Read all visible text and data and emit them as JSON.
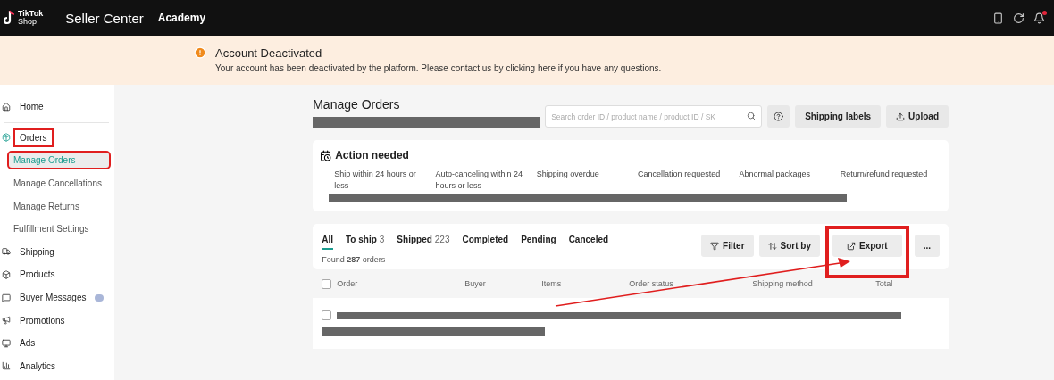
{
  "header": {
    "logo_top": "TikTok",
    "logo_bottom": "Shop",
    "product": "Seller Center",
    "link": "Academy",
    "notification_dot": true
  },
  "banner": {
    "title": "Account Deactivated",
    "message_before": "Your account has been deactivated by the platform. Please contact us by clicking",
    "link": "here",
    "message_after": "if you have any questions."
  },
  "sidebar": {
    "items": [
      {
        "label": "Home",
        "selected": false,
        "highlighted": false
      },
      {
        "label": "Orders",
        "selected": false,
        "highlighted": true,
        "children": [
          {
            "label": "Manage Orders",
            "selected": true,
            "highlighted": true
          },
          {
            "label": "Manage Cancellations",
            "selected": false,
            "highlighted": false
          },
          {
            "label": "Manage Returns",
            "selected": false,
            "highlighted": false
          },
          {
            "label": "Fulfillment Settings",
            "selected": false,
            "highlighted": false
          }
        ]
      },
      {
        "label": "Shipping",
        "selected": false,
        "highlighted": false
      },
      {
        "label": "Products",
        "selected": false,
        "highlighted": false
      },
      {
        "label": "Buyer Messages",
        "selected": false,
        "highlighted": false,
        "help": true
      },
      {
        "label": "Promotions",
        "selected": false,
        "highlighted": false
      },
      {
        "label": "Ads",
        "selected": false,
        "highlighted": false
      },
      {
        "label": "Analytics",
        "selected": false,
        "highlighted": false
      }
    ]
  },
  "page": {
    "title": "Manage Orders",
    "subtitle_redacted": true,
    "search": {
      "placeholder": "Search order ID / product name / product ID / SK"
    },
    "buttons": [
      {
        "label": "Shipping labels"
      },
      {
        "label": "Upload"
      }
    ]
  },
  "action_needed": {
    "title": "Action needed",
    "items": [
      "Ship within 24 hours or less",
      "Auto-canceling within 24 hours or less",
      "Shipping overdue",
      "Cancellation requested",
      "Abnormal packages",
      "Return/refund requested"
    ],
    "counts_redacted": true
  },
  "orders": {
    "tabs": [
      {
        "label": "All",
        "selected": true
      },
      {
        "label": "To ship",
        "count": "3",
        "selected": false
      },
      {
        "label": "Shipped",
        "count": "223",
        "selected": false
      },
      {
        "label": "Completed",
        "selected": false
      },
      {
        "label": "Pending",
        "selected": false
      },
      {
        "label": "Canceled",
        "selected": false
      }
    ],
    "found": "Found **287** orders",
    "tools": [
      {
        "label": "Filter",
        "kind": "filter",
        "highlighted": false
      },
      {
        "label": "Sort by",
        "kind": "sort",
        "highlighted": false
      },
      {
        "label": "Export",
        "kind": "export",
        "highlighted": true
      },
      {
        "label": "...",
        "kind": "more",
        "highlighted": false
      }
    ],
    "select_all_checked": false,
    "columns": [
      "Order",
      "Buyer",
      "Items",
      "Order status",
      "Shipping method",
      "Total"
    ],
    "rows": [
      {
        "redacted": true,
        "checked": false
      }
    ]
  },
  "annotation_arrow": true
}
